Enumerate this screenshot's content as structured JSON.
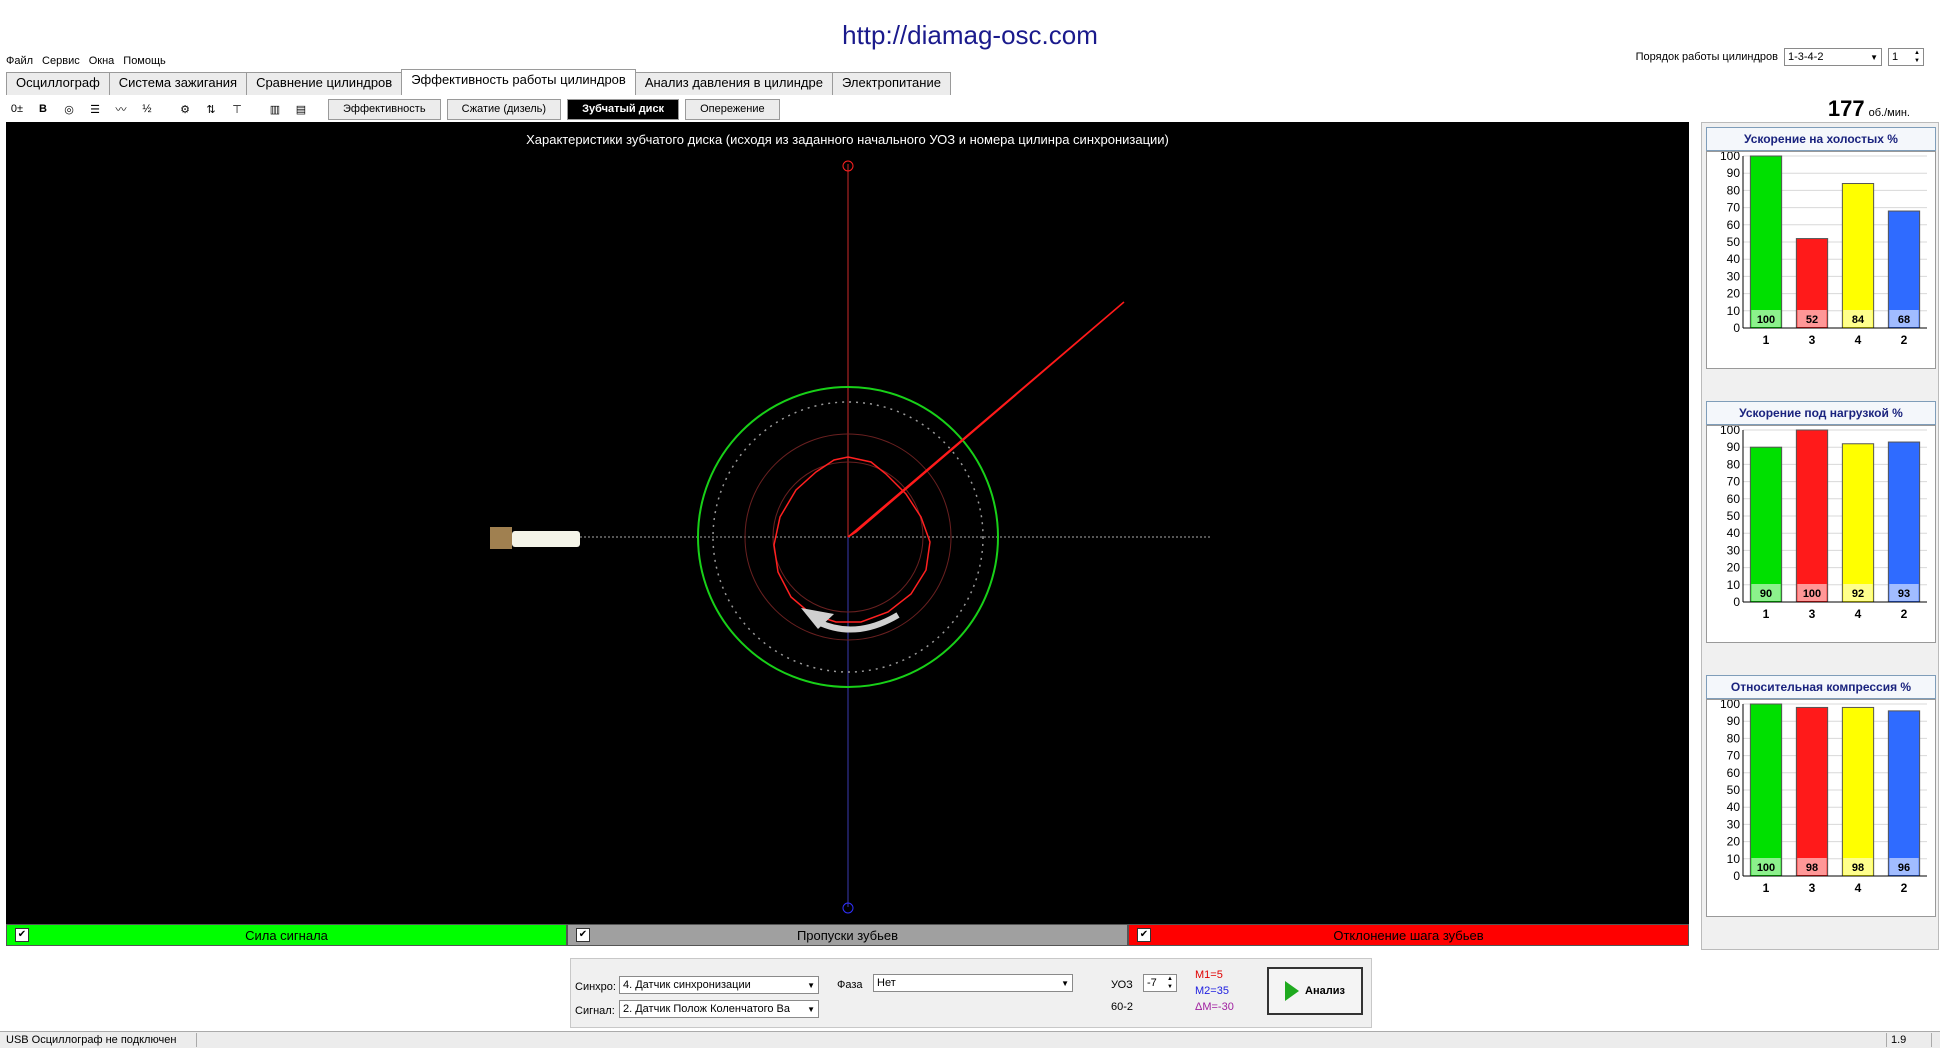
{
  "url_banner": "http://diamag-osc.com",
  "menu": [
    "Файл",
    "Сервис",
    "Окна",
    "Помощь"
  ],
  "order": {
    "label": "Порядок работы цилиндров",
    "value": "1-3-4-2",
    "cyl": "1"
  },
  "tabs": [
    {
      "label": "Осциллограф",
      "active": false
    },
    {
      "label": "Система зажигания",
      "active": false
    },
    {
      "label": "Сравнение цилиндров",
      "active": false
    },
    {
      "label": "Эффективность работы цилиндров",
      "active": true
    },
    {
      "label": "Анализ давления в цилиндре",
      "active": false
    },
    {
      "label": "Электропитание",
      "active": false
    }
  ],
  "subtabs": [
    {
      "label": "Эффективность",
      "active": false
    },
    {
      "label": "Сжатие (дизель)",
      "active": false
    },
    {
      "label": "Зубчатый диск",
      "active": true
    },
    {
      "label": "Опережение",
      "active": false
    }
  ],
  "rpm": {
    "value": "177",
    "unit": "об./мин."
  },
  "scope": {
    "title": "Характеристики зубчатого диска (исходя из заданного начального УОЗ и номера цилинра синхронизации)"
  },
  "bottom_bars": [
    {
      "label": "Сила сигнала",
      "color": "#00ff00",
      "checked": true
    },
    {
      "label": "Пропуски зубьев",
      "color": "#a0a0a0",
      "checked": true
    },
    {
      "label": "Отклонение шага зубьев",
      "color": "#ff0000",
      "checked": true
    }
  ],
  "charts": [
    {
      "title": "Ускорение на холостых %",
      "categories": [
        "1",
        "3",
        "4",
        "2"
      ],
      "values": [
        100,
        52,
        84,
        68
      ],
      "colors": [
        "#00e000",
        "#ff1a1a",
        "#ffff00",
        "#2f6bff"
      ]
    },
    {
      "title": "Ускорение под нагрузкой %",
      "categories": [
        "1",
        "3",
        "4",
        "2"
      ],
      "values": [
        90,
        100,
        92,
        93
      ],
      "colors": [
        "#00e000",
        "#ff1a1a",
        "#ffff00",
        "#2f6bff"
      ]
    },
    {
      "title": "Относительная компрессия %",
      "categories": [
        "1",
        "3",
        "4",
        "2"
      ],
      "values": [
        100,
        98,
        98,
        96
      ],
      "colors": [
        "#00e000",
        "#ff1a1a",
        "#ffff00",
        "#2f6bff"
      ]
    }
  ],
  "chart_data": [
    {
      "type": "bar",
      "title": "Ускорение на холостых %",
      "categories": [
        "1",
        "3",
        "4",
        "2"
      ],
      "values": [
        100,
        52,
        84,
        68
      ],
      "ylim": [
        0,
        100
      ]
    },
    {
      "type": "bar",
      "title": "Ускорение под нагрузкой %",
      "categories": [
        "1",
        "3",
        "4",
        "2"
      ],
      "values": [
        90,
        100,
        92,
        93
      ],
      "ylim": [
        0,
        100
      ]
    },
    {
      "type": "bar",
      "title": "Относительная компрессия %",
      "categories": [
        "1",
        "3",
        "4",
        "2"
      ],
      "values": [
        100,
        98,
        98,
        96
      ],
      "ylim": [
        0,
        100
      ]
    }
  ],
  "y_ticks": [
    "100",
    "90",
    "80",
    "70",
    "60",
    "50",
    "40",
    "30",
    "20",
    "10",
    "0"
  ],
  "controls": {
    "sync_label": "Синхро:",
    "sync_value": "4.  Датчик синхронизации",
    "signal_label": "Сигнал:",
    "signal_value": "2.  Датчик Полож Коленчатого Ва",
    "phase_label": "Фаза",
    "phase_value": "Нет",
    "uoz_label": "УОЗ",
    "uoz_value": "-7",
    "disk": "60-2",
    "m1": "M1=5",
    "m2": "M2=35",
    "dm": "ΔM=-30",
    "analyze_label": "Анализ"
  },
  "status": {
    "left": "USB Осциллограф не подключен",
    "right": "1.9"
  }
}
